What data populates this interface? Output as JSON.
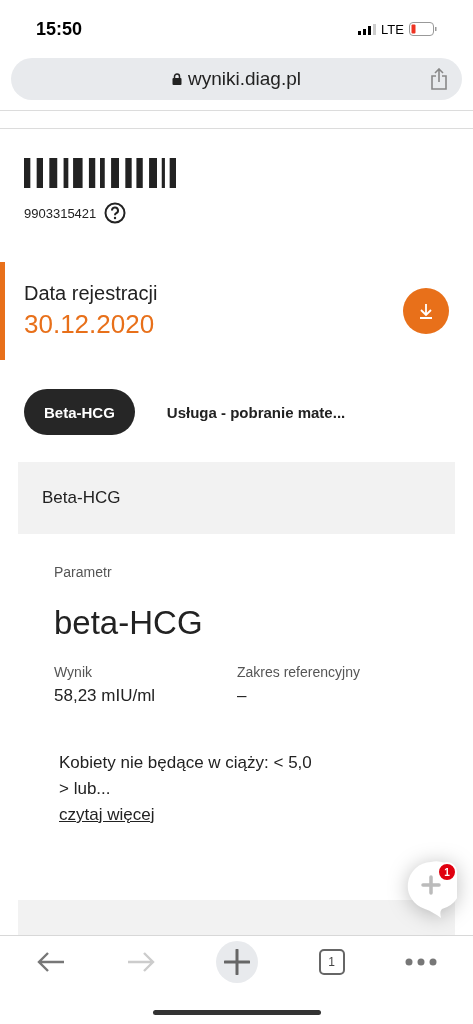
{
  "status_bar": {
    "time": "15:50",
    "network": "LTE"
  },
  "browser": {
    "url": "wyniki.diag.pl"
  },
  "barcode": {
    "number": "9903315421"
  },
  "registration": {
    "label": "Data rejestracji",
    "date": "30.12.2020"
  },
  "tabs": [
    {
      "label": "Beta-HCG",
      "selected": true
    },
    {
      "label": "Usługa - pobranie mate...",
      "selected": false
    }
  ],
  "section": {
    "title": "Beta-HCG"
  },
  "parameter": {
    "label": "Parametr",
    "name": "beta-HCG",
    "result_label": "Wynik",
    "result_value": "58,23 mIU/ml",
    "reference_label": "Zakres referencyjny",
    "reference_value": "–"
  },
  "note": {
    "lines": [
      "Kobiety nie będące w ciąży: < 5,0",
      "> lub..."
    ],
    "link": "czytaj więcej"
  },
  "chat": {
    "badge": "1"
  },
  "toolbar": {
    "back_disabled": false,
    "forward_disabled": true,
    "tab_count": "1"
  }
}
